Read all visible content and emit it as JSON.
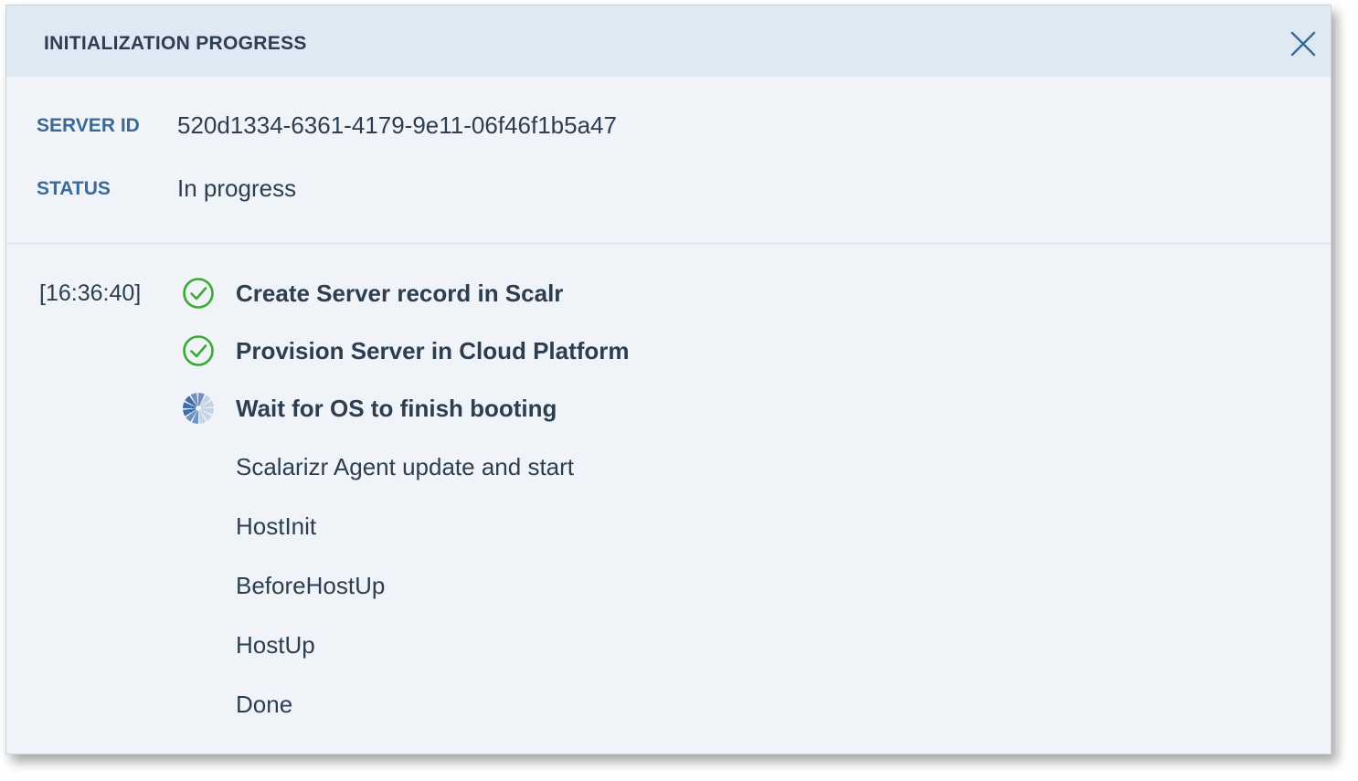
{
  "dialog": {
    "title": "INITIALIZATION PROGRESS",
    "close_icon": "close-icon"
  },
  "info": {
    "server_id_label": "SERVER ID",
    "server_id_value": "520d1334-6361-4179-9e11-06f46f1b5a47",
    "status_label": "STATUS",
    "status_value": "In progress"
  },
  "steps": [
    {
      "timestamp": "[16:36:40]",
      "label": "Create Server record in Scalr",
      "state": "done",
      "icon": "check-circle-icon"
    },
    {
      "timestamp": "",
      "label": "Provision Server in Cloud Platform",
      "state": "done",
      "icon": "check-circle-icon"
    },
    {
      "timestamp": "",
      "label": "Wait for OS to finish booting",
      "state": "in-progress",
      "icon": "spinner-icon"
    },
    {
      "timestamp": "",
      "label": "Scalarizr Agent update and start",
      "state": "pending",
      "icon": ""
    },
    {
      "timestamp": "",
      "label": "HostInit",
      "state": "pending",
      "icon": ""
    },
    {
      "timestamp": "",
      "label": "BeforeHostUp",
      "state": "pending",
      "icon": ""
    },
    {
      "timestamp": "",
      "label": "HostUp",
      "state": "pending",
      "icon": ""
    },
    {
      "timestamp": "",
      "label": "Done",
      "state": "pending",
      "icon": ""
    }
  ],
  "colors": {
    "header_bg": "#dfe9f3",
    "body_bg": "#f0f3f8",
    "label_blue": "#3b6a96",
    "text_dark": "#2c3e50",
    "success_green": "#3aaa35",
    "spinner_blue": "#6f93c0"
  }
}
